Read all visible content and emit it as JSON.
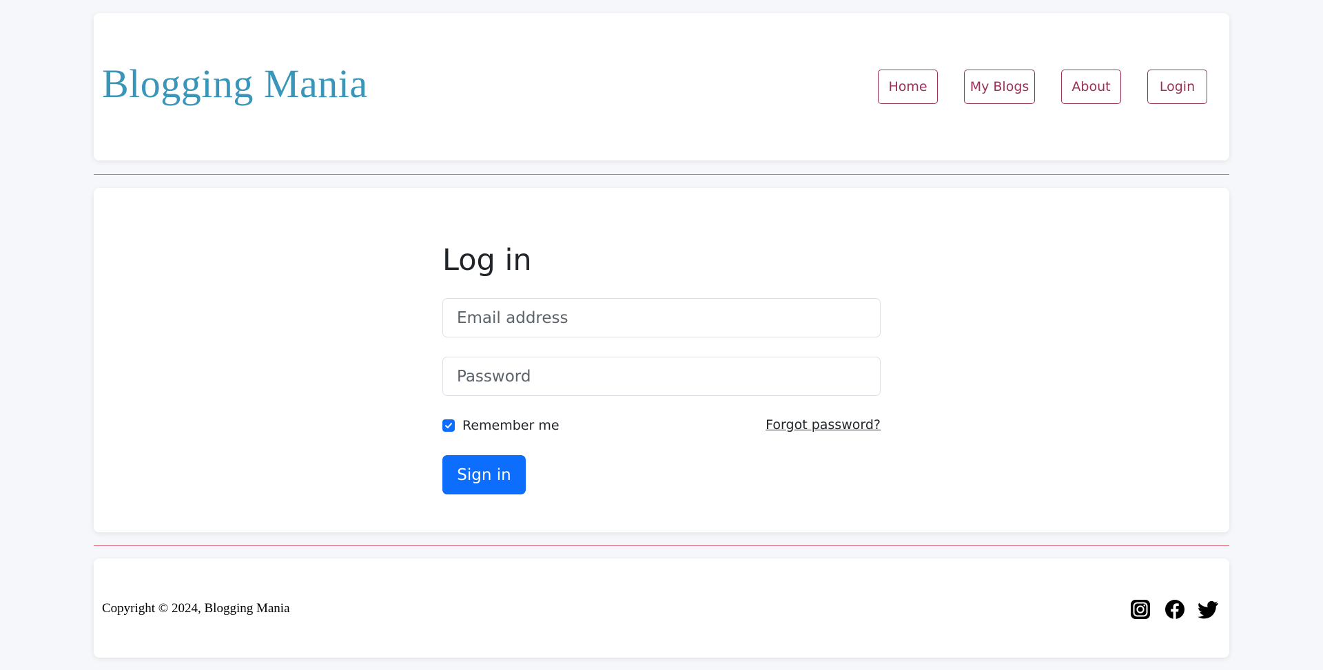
{
  "header": {
    "brand": "Blogging Mania",
    "nav": {
      "home": "Home",
      "my_blogs": "My Blogs",
      "about": "About",
      "login": "Login"
    }
  },
  "login_form": {
    "title": "Log in",
    "email": {
      "placeholder": "Email address",
      "value": ""
    },
    "password": {
      "placeholder": "Password",
      "value": ""
    },
    "remember_label": "Remember me",
    "remember_checked": true,
    "forgot_link": "Forgot password?",
    "submit_label": "Sign in"
  },
  "footer": {
    "copyright": "Copyright © 2024, Blogging Mania",
    "social_icons": [
      "instagram-icon",
      "facebook-icon",
      "twitter-icon"
    ]
  },
  "colors": {
    "brand": "#3a96b9",
    "nav_accent": "#99315a",
    "primary": "#0d6efd",
    "divider": "#d9707f",
    "page_bg": "#f5f7fa"
  }
}
